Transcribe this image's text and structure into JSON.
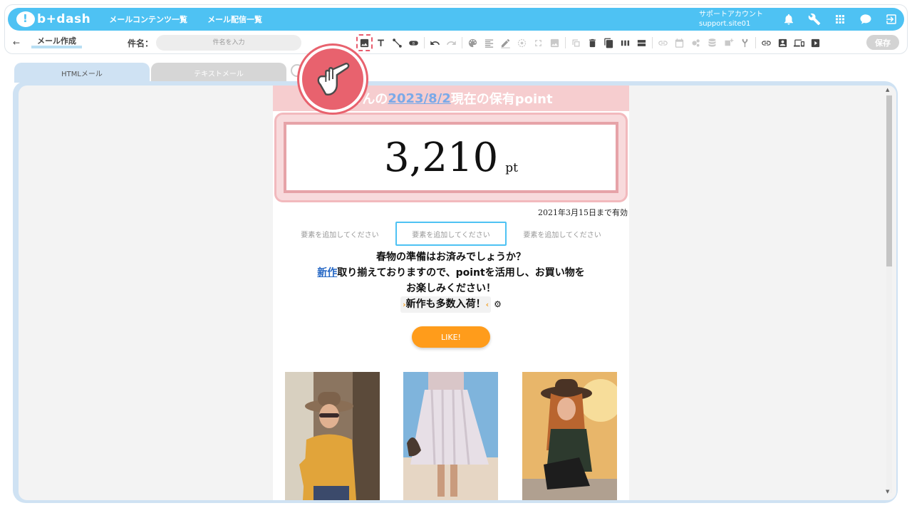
{
  "header": {
    "logo_text": "b+dash",
    "nav": [
      "メールコンテンツ一覧",
      "メール配信一覧"
    ],
    "account_name": "サポートアカウント",
    "account_id": "support.site01"
  },
  "toolbar": {
    "back_arrow": "←",
    "page_title": "メール作成",
    "subject_label": "件名：",
    "subject_placeholder": "件名を入力",
    "save_label": "保存"
  },
  "tabs": {
    "html": "HTMLメール",
    "text": "テキストメール"
  },
  "email": {
    "head_prefix": "さんの",
    "head_date": "2023/8/2",
    "head_suffix": "現在の保有point",
    "point_value": "3,210",
    "point_unit": "pt",
    "expire_note": "2021年3月15日まで有効",
    "add_slots": [
      "要素を追加してください",
      "要素を追加してください",
      "要素を追加してください"
    ],
    "line1": "春物の準備はお済みでしょうか？",
    "line2_link": "新作",
    "line2_rest": "取り揃えておりますので、pointを活用し、お買い物を",
    "line3": "お楽しみください！",
    "line4_open": "›",
    "line4": "新作も多数入荷！",
    "line4_close": "‹",
    "gear_icon": "⚙",
    "like_label": "LIKE!"
  },
  "icons": {
    "bell": "bell-icon",
    "wrench": "wrench-icon",
    "grid": "grid-icon",
    "chat": "chat-icon",
    "logout": "logout-icon"
  },
  "colors": {
    "brand": "#4ec2f3",
    "accent_pink": "#e8626e",
    "like_orange": "#ff9c1b"
  }
}
